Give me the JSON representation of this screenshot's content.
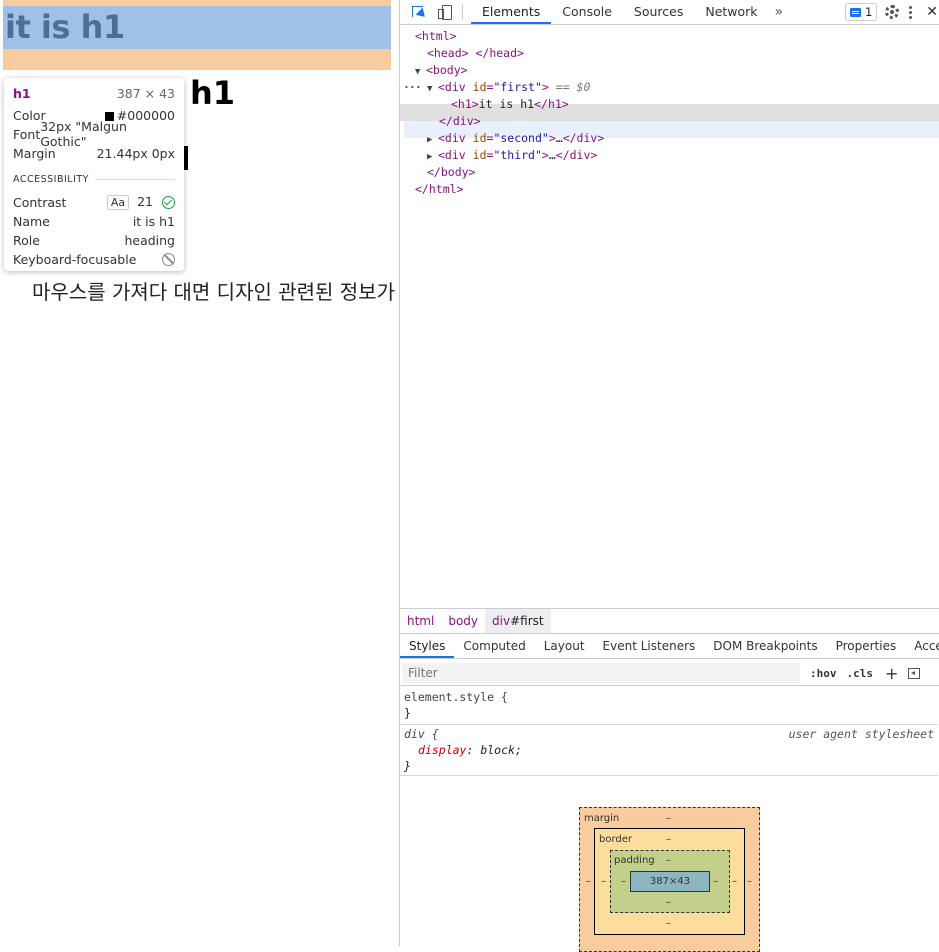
{
  "page": {
    "heading_text": "it is h1",
    "heading_behind": "h1",
    "description": "마우스를 가져다 대면 디자인 관련된 정보가 나온다"
  },
  "tooltip": {
    "tag": "h1",
    "dimensions": "387 × 43",
    "color_label": "Color",
    "color_value": "#000000",
    "font_label": "Font",
    "font_value": "32px \"Malgun Gothic\"",
    "margin_label": "Margin",
    "margin_value": "21.44px 0px",
    "section_title": "ACCESSIBILITY",
    "contrast_label": "Contrast",
    "contrast_aa": "Aa",
    "contrast_value": "21",
    "name_label": "Name",
    "name_value": "it is h1",
    "role_label": "Role",
    "role_value": "heading",
    "keyboard_label": "Keyboard-focusable"
  },
  "devtools": {
    "tabs": [
      "Elements",
      "Console",
      "Sources",
      "Network"
    ],
    "more_tabs": "»",
    "issues_count": "1",
    "close_symbol": "✕",
    "dom": {
      "html_open": "<html>",
      "head": "<head>",
      "head_close": "</head>",
      "body_open": "<body>",
      "div_open": "<div",
      "attr_id": "id",
      "first_val": "\"first\"",
      "gt": ">",
      "selected_marker": "== $0",
      "h1_open": "<h1>",
      "h1_text": "it is h1",
      "h1_close": "</h1>",
      "div_close": "</div>",
      "second_val": "\"second\"",
      "third_val": "\"third\"",
      "ellipsis": "…",
      "body_close": "</body>",
      "html_close": "</html>",
      "row_dots": "···"
    },
    "breadcrumb": {
      "html": "html",
      "body": "body",
      "div_tag": "div",
      "div_id": "#first"
    },
    "style_tabs": [
      "Styles",
      "Computed",
      "Layout",
      "Event Listeners",
      "DOM Breakpoints",
      "Properties",
      "Accessibility"
    ],
    "filter_placeholder": "Filter",
    "hov": ":hov",
    "cls": ".cls",
    "plus": "+",
    "rules": {
      "element_selector": "element.style {",
      "close_brace": "}",
      "div_selector": "div {",
      "ua_label": "user agent stylesheet",
      "prop_name": "display",
      "prop_value": "block;"
    },
    "box_model": {
      "margin_label": "margin",
      "border_label": "border",
      "padding_label": "padding",
      "content_size": "387×43",
      "dash": "–"
    }
  },
  "colors": {
    "highlight_margin": "#f9cc9d",
    "highlight_content": "#9fc1e7",
    "accent": "#1a73e8",
    "tag_color": "#881280"
  }
}
